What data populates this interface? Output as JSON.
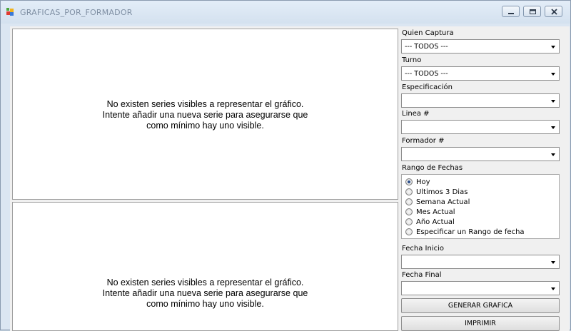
{
  "window": {
    "title": "GRAFICAS_POR_FORMADOR"
  },
  "charts": {
    "top": {
      "message": [
        "No existen series visibles a representar el gráfico.",
        "Intente añadir una nueva serie para asegurarse que",
        "como mínimo hay uno visible."
      ]
    },
    "bottom": {
      "message": [
        "No existen series visibles a representar el gráfico.",
        "Intente añadir una nueva serie para asegurarse que",
        "como mínimo hay uno visible."
      ]
    }
  },
  "filters": {
    "quien_captura": {
      "label": "Quien Captura",
      "value": "--- TODOS ---"
    },
    "turno": {
      "label": "Turno",
      "value": "--- TODOS ---"
    },
    "especificacion": {
      "label": "Especificación",
      "value": ""
    },
    "linea": {
      "label": "Linea #",
      "value": ""
    },
    "formador": {
      "label": "Formador #",
      "value": ""
    }
  },
  "date_range": {
    "label": "Rango de Fechas",
    "options": [
      "Hoy",
      "Ultimos 3 Dias",
      "Semana Actual",
      "Mes Actual",
      "Año Actual",
      "Especificar un Rango de fecha"
    ],
    "selected": "Hoy"
  },
  "fecha_inicio": {
    "label": "Fecha Inicio",
    "value": ""
  },
  "fecha_final": {
    "label": "Fecha Final",
    "value": ""
  },
  "buttons": {
    "generar": "GENERAR GRAFICA",
    "imprimir": "IMPRIMIR"
  },
  "icons": [
    "app-icon",
    "minimize-icon",
    "maximize-icon",
    "close-icon",
    "dropdown-arrow-icon"
  ]
}
